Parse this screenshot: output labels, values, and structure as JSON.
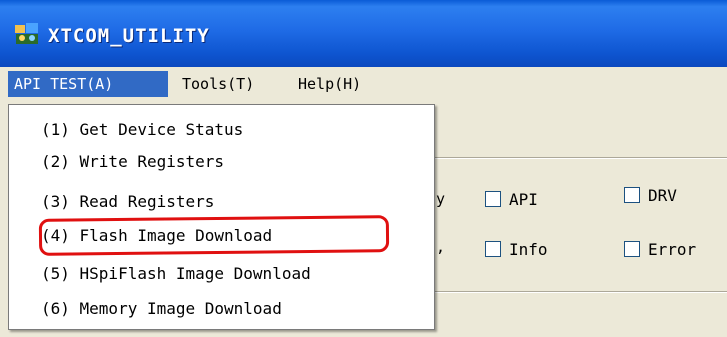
{
  "window": {
    "title": "XTCOM_UTILITY",
    "icon": "app-icon",
    "colors": {
      "title_bar": "#0e55d0",
      "menu_bar": "#ece9d8",
      "selection": "#316ac5",
      "annotation": "#e01010"
    }
  },
  "menubar": {
    "items": [
      {
        "label": "API TEST(A)",
        "active": true
      },
      {
        "label": "Tools(T)",
        "active": false
      },
      {
        "label": "Help(H)",
        "active": false
      }
    ]
  },
  "dropdown": {
    "items": [
      {
        "label": "(1) Get Device Status"
      },
      {
        "label": "(2) Write Registers"
      },
      {
        "label": "(3) Read Registers"
      },
      {
        "label": "(4) Flash Image Download",
        "annotated": true
      },
      {
        "label": "(5) HSpiFlash Image Download"
      },
      {
        "label": "(6) Memory Image Download"
      }
    ]
  },
  "options": {
    "partial_1": "y",
    "partial_2": ",",
    "checkboxes": [
      {
        "label": "API",
        "checked": false
      },
      {
        "label": "DRV",
        "checked": false
      },
      {
        "label": "Info",
        "checked": false
      },
      {
        "label": "Error",
        "checked": false
      }
    ]
  }
}
